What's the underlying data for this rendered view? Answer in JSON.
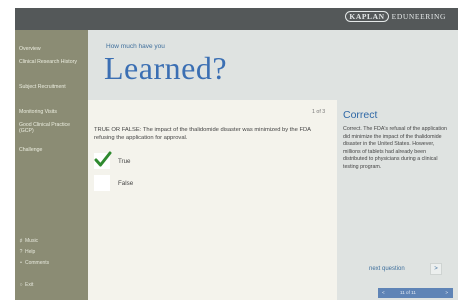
{
  "brand": {
    "name": "KAPLAN",
    "division": "EDUNEERING"
  },
  "sidebar": {
    "items": [
      {
        "label": "Overview"
      },
      {
        "label": "Clinical Research History"
      },
      {
        "label": "Subject Recruitment"
      },
      {
        "label": "Monitoring Visits"
      },
      {
        "label": "Good Clinical Practice (GCP)"
      },
      {
        "label": "Challenge"
      }
    ],
    "tools": [
      {
        "label": "Music",
        "icon": "speaker-icon"
      },
      {
        "label": "Help",
        "icon": "help-icon"
      },
      {
        "label": "Comments",
        "icon": "comment-icon"
      },
      {
        "label": "Exit",
        "icon": "power-icon"
      }
    ]
  },
  "header": {
    "subtitle": "How much have you",
    "title": "Learned?"
  },
  "quiz": {
    "counter": "1 of 3",
    "question": "TRUE OR FALSE: The impact of the thalidomide disaster was minimized by the FDA refusing the application for approval.",
    "options": [
      {
        "label": "True",
        "selected": true
      },
      {
        "label": "False",
        "selected": false
      }
    ]
  },
  "feedback": {
    "title": "Correct",
    "text": "Correct. The FDA's refusal of the application did minimize the impact of the thalidomide disaster in the United States. However, millions of tablets had already been distributed to physicians during a clinical testing program.",
    "next_label": "next question",
    "next_arrow": ">"
  },
  "pager": {
    "prev": "<",
    "page": "11 of 11",
    "next": ">"
  },
  "colors": {
    "accent": "#3b6fb3",
    "check": "#2f8a2f",
    "sidebar": "#8b8c74",
    "frame": "#545859"
  }
}
